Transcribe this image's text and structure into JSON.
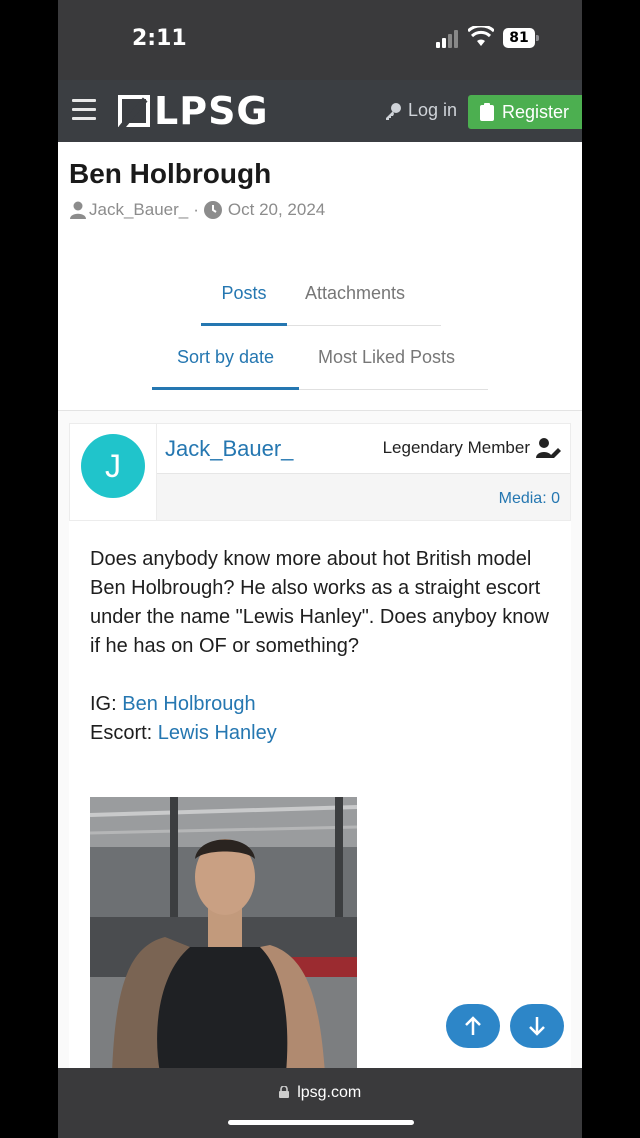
{
  "status_bar": {
    "time": "2:11",
    "battery": "81"
  },
  "header": {
    "logo": "LPSG",
    "login_label": "Log in",
    "register_label": "Register"
  },
  "thread": {
    "title": "Ben Holbrough",
    "author": "Jack_Bauer_",
    "separator": "·",
    "date": "Oct 20, 2024"
  },
  "tabs": {
    "posts": "Posts",
    "attachments": "Attachments"
  },
  "sort_tabs": {
    "by_date": "Sort by date",
    "most_liked": "Most Liked Posts"
  },
  "post": {
    "avatar_letter": "J",
    "username": "Jack_Bauer_",
    "rank": "Legendary Member",
    "media": "Media: 0",
    "body": "Does anybody know more about hot British model Ben Holbrough? He also works as a straight escort under the name \"Lewis Hanley\". Does anyboy know if he has on OF or something?",
    "ig_label": "IG: ",
    "ig_link": "Ben Holbrough",
    "escort_label": "Escort: ",
    "escort_link": "Lewis Hanley"
  },
  "browser": {
    "url": "lpsg.com"
  },
  "colors": {
    "accent": "#2577b1",
    "register": "#4caf50",
    "avatar": "#20c4cb",
    "navbar": "#3b3e42"
  }
}
